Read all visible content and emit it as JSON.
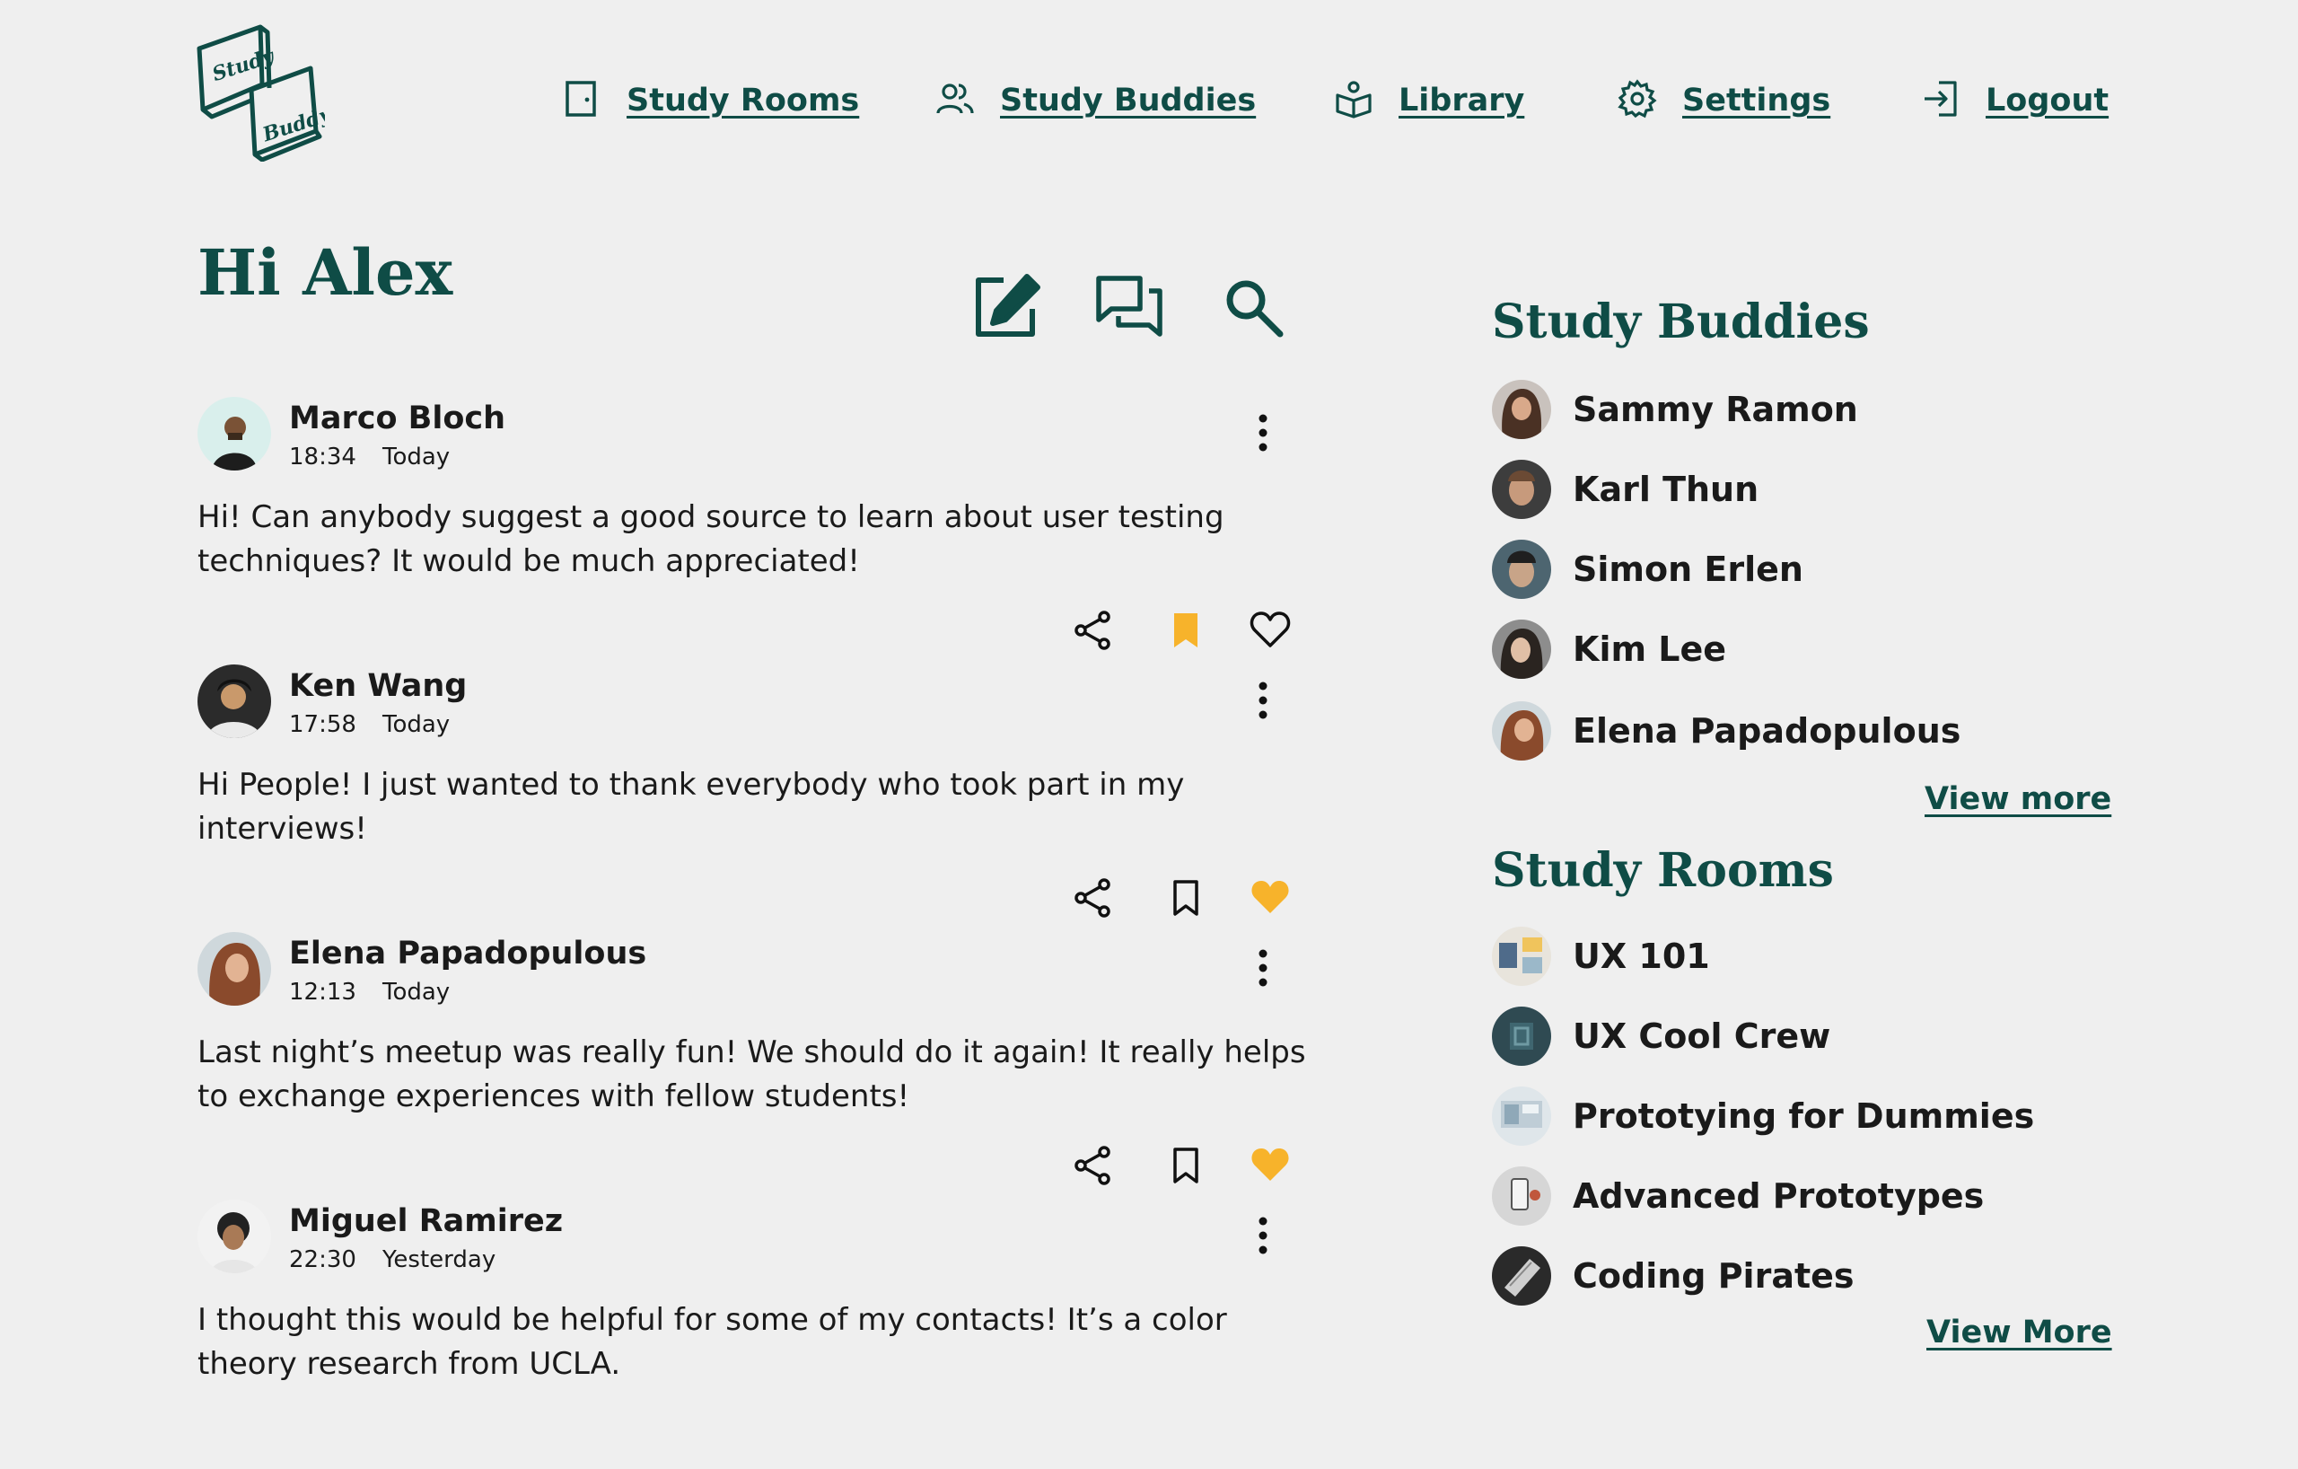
{
  "brand": {
    "logo_line1": "Study",
    "logo_line2": "Buddy"
  },
  "nav": [
    {
      "label": "Study Rooms",
      "icon": "door-icon"
    },
    {
      "label": "Study Buddies",
      "icon": "users-icon"
    },
    {
      "label": "Library",
      "icon": "book-icon"
    },
    {
      "label": "Settings",
      "icon": "gear-icon"
    },
    {
      "label": "Logout",
      "icon": "logout-icon"
    }
  ],
  "greeting": "Hi Alex",
  "toolbar": {
    "icons": [
      "edit-icon",
      "chat-icon",
      "search-icon"
    ]
  },
  "colors": {
    "brand": "#0f4c46",
    "accent": "#f7b32b",
    "background": "#efefef"
  },
  "posts": [
    {
      "author": "Marco Bloch",
      "time": "18:34",
      "day": "Today",
      "text": "Hi! Can anybody suggest a good source to learn about user testing techniques? It would be much appreciated!",
      "bookmarked": true,
      "liked": false
    },
    {
      "author": "Ken Wang",
      "time": "17:58",
      "day": "Today",
      "text": "Hi People! I just wanted to thank everybody who took part in my interviews!",
      "bookmarked": false,
      "liked": true
    },
    {
      "author": "Elena Papadopulous",
      "time": "12:13",
      "day": "Today",
      "text": "Last night’s meetup was really fun! We should do it again! It really helps to exchange experiences with fellow students!",
      "bookmarked": false,
      "liked": true
    },
    {
      "author": "Miguel Ramirez",
      "time": "22:30",
      "day": "Yesterday",
      "text": "I thought this would be helpful for some of my contacts! It’s a color theory research from UCLA.",
      "bookmarked": false,
      "liked": false
    }
  ],
  "sidebar": {
    "buddies_title": "Study Buddies",
    "buddies": [
      "Sammy Ramon",
      "Karl Thun",
      "Simon Erlen",
      "Kim Lee",
      "Elena Papadopulous"
    ],
    "buddies_more": "View more",
    "rooms_title": "Study Rooms",
    "rooms": [
      "UX 101",
      "UX Cool Crew",
      "Prototying for Dummies",
      "Advanced Prototypes",
      "Coding Pirates"
    ],
    "rooms_more": "View More"
  }
}
